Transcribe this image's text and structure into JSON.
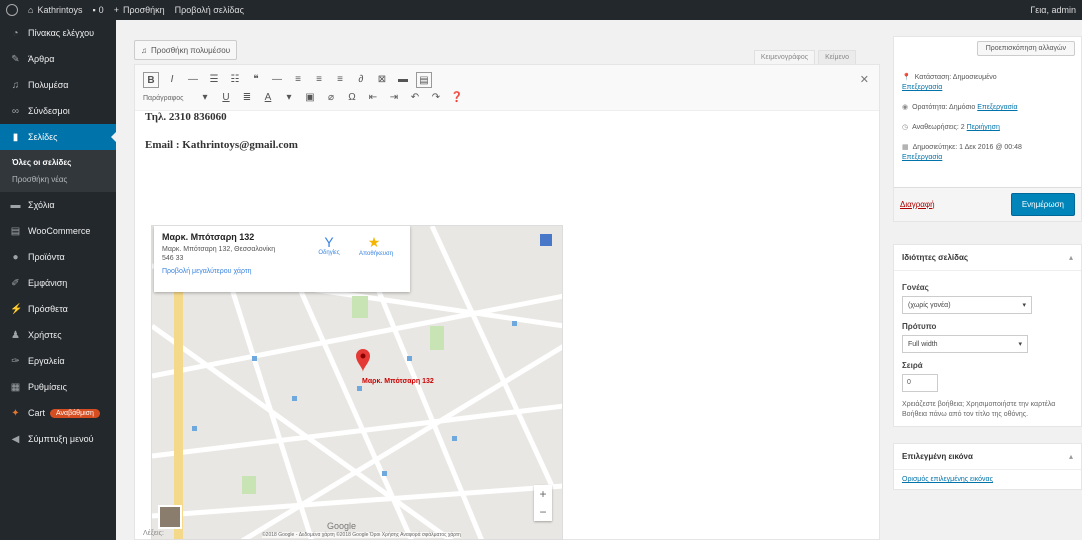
{
  "adminbar": {
    "site_name": "Kathrintoys",
    "comments_count": "0",
    "new_label": "Προσθήκη",
    "view_label": "Προβολή σελίδας",
    "greeting": "Γεια, admin"
  },
  "sidebar": {
    "items": [
      {
        "label": "Πίνακας ελέγχου",
        "icon": "dashboard-icon"
      },
      {
        "label": "Άρθρα",
        "icon": "pin-icon"
      },
      {
        "label": "Πολυμέσα",
        "icon": "media-icon"
      },
      {
        "label": "Σύνδεσμοι",
        "icon": "link-icon"
      },
      {
        "label": "Σελίδες",
        "icon": "page-icon"
      },
      {
        "label": "Σχόλια",
        "icon": "comment-icon"
      },
      {
        "label": "WooCommerce",
        "icon": "woo-icon"
      },
      {
        "label": "Προϊόντα",
        "icon": "product-icon"
      },
      {
        "label": "Εμφάνιση",
        "icon": "brush-icon"
      },
      {
        "label": "Πρόσθετα",
        "icon": "plugin-icon"
      },
      {
        "label": "Χρήστες",
        "icon": "user-icon"
      },
      {
        "label": "Εργαλεία",
        "icon": "wrench-icon"
      },
      {
        "label": "Ρυθμίσεις",
        "icon": "settings-icon"
      },
      {
        "label": "Cart",
        "icon": "cart-icon",
        "badge": "Αναβάθμιση"
      },
      {
        "label": "Σύμπτυξη μενού",
        "icon": "collapse-icon"
      }
    ],
    "submenu": [
      "Όλες οι σελίδες",
      "Προσθήκη νέας"
    ]
  },
  "editor": {
    "add_media": "Προσθήκη πολυμέσου",
    "tab_visual": "Κειμενογράφος",
    "tab_text": "Κείμενο",
    "format_select": "Παράγραφος",
    "phone_line": "Τηλ. 2310 836060",
    "email_line": "Email : Kathrintoys@gmail.com",
    "word_count": "Λέξεις: "
  },
  "map": {
    "place_title": "Μαρκ. Μπότσαρη 132",
    "place_address": "Μαρκ. Μπότσαρη 132, Θεσσαλονίκη 546 33",
    "directions_label": "Οδηγίες",
    "save_label": "Αποθήκευση",
    "larger_map_link": "Προβολή μεγαλύτερου χάρτη",
    "pin_label": "Μαρκ. Μπότσαρη 132",
    "google_label": "Google",
    "attribution": "©2018 Google - Δεδομένα χάρτη ©2018 Google   Όροι Χρήσης   Αναφορά σφάλματος χάρτη"
  },
  "publish": {
    "preview_button": "Προεπισκόπηση αλλαγών",
    "status_label": "Κατάσταση: Δημοσιευμένο",
    "status_edit": "Επεξεργασία",
    "visibility_label": "Ορατότητα: Δημόσιο",
    "visibility_edit": "Επεξεργασία",
    "revisions_label": "Αναθεωρήσεις: 2",
    "revisions_link": "Περιήγηση",
    "published_label": "Δημοσιεύτηκε: 1 Δεκ 2016 @ 00:48",
    "published_edit": "Επεξεργασία",
    "trash_link": "Διαγραφή",
    "update_button": "Ενημέρωση"
  },
  "attributes": {
    "title": "Ιδιότητες σελίδας",
    "parent_label": "Γονέας",
    "parent_value": "(χωρίς γονέα)",
    "template_label": "Πρότυπο",
    "template_value": "Full width",
    "order_label": "Σειρά",
    "order_value": "0",
    "help_text": "Χρειάζεστε βοήθεια; Χρησιμοποιήστε την καρτέλα Βοήθεια πάνω από τον τίτλο της οθόνης."
  },
  "featured": {
    "title": "Επιλεγμένη εικόνα",
    "link": "Ορισμός επιλεγμένης εικόνας"
  },
  "colors": {
    "admin_bg": "#23282d",
    "accent": "#0073aa",
    "update": "#0085ba"
  }
}
